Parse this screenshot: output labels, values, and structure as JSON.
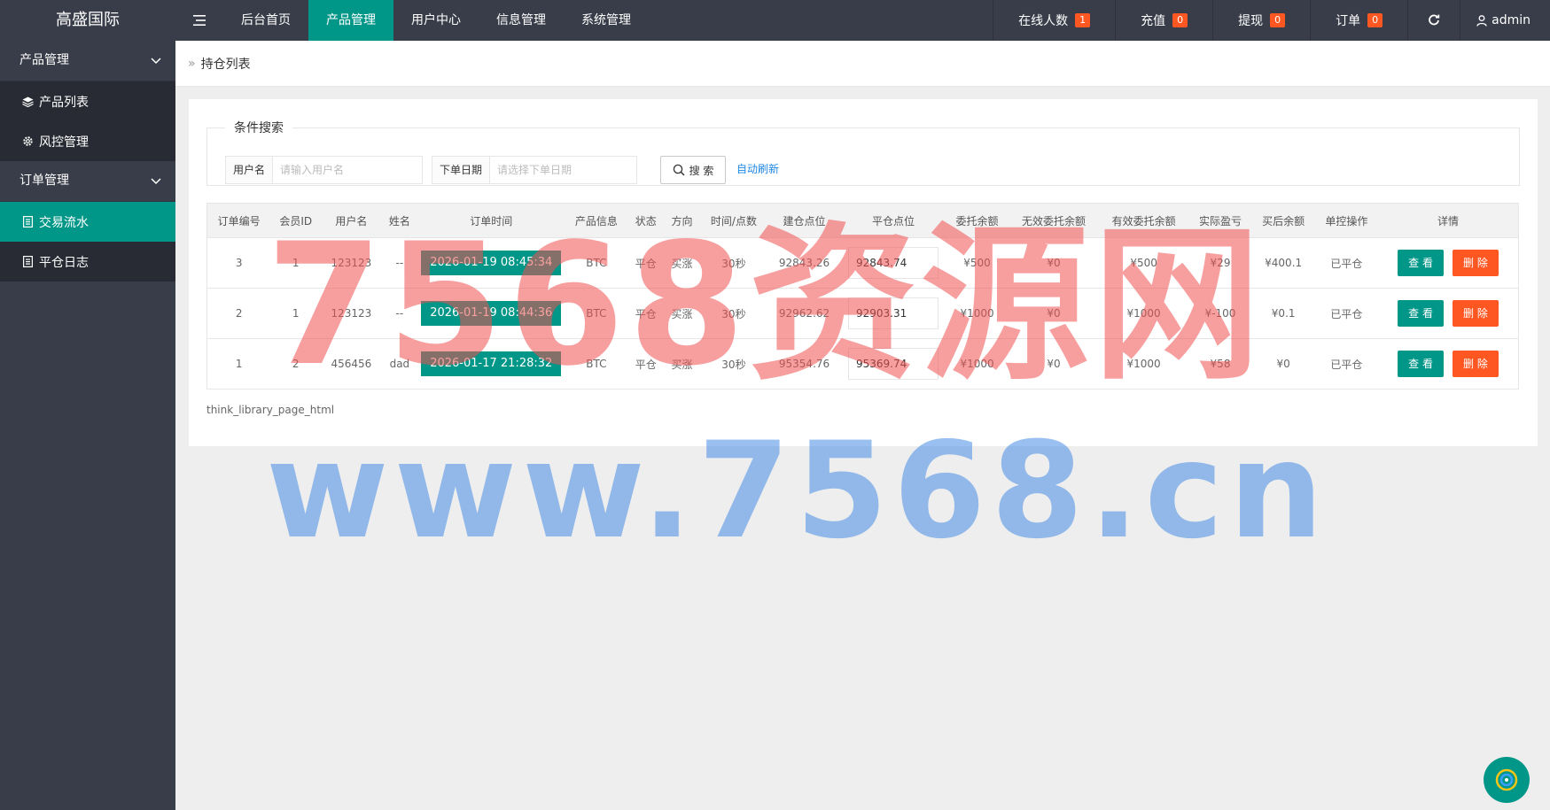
{
  "header": {
    "logo": "高盛国际",
    "nav": [
      "后台首页",
      "产品管理",
      "用户中心",
      "信息管理",
      "系统管理"
    ],
    "active_nav": 1,
    "right": {
      "online_label": "在线人数",
      "online_count": "1",
      "recharge_label": "充值",
      "recharge_count": "0",
      "withdraw_label": "提现",
      "withdraw_count": "0",
      "order_label": "订单",
      "order_count": "0",
      "user": "admin"
    }
  },
  "sidebar": {
    "group1": "产品管理",
    "items1": [
      "产品列表",
      "风控管理"
    ],
    "group2": "订单管理",
    "items2": [
      "交易流水",
      "平仓日志"
    ]
  },
  "breadcrumb": "持仓列表",
  "search": {
    "legend": "条件搜索",
    "username_label": "用户名",
    "username_placeholder": "请输入用户名",
    "date_label": "下单日期",
    "date_placeholder": "请选择下单日期",
    "search_btn": "搜 索",
    "auto_refresh": "自动刷新"
  },
  "table": {
    "headers": [
      "订单编号",
      "会员ID",
      "用户名",
      "姓名",
      "订单时间",
      "产品信息",
      "状态",
      "方向",
      "时间/点数",
      "建仓点位",
      "平仓点位",
      "委托余额",
      "无效委托余额",
      "有效委托余额",
      "实际盈亏",
      "买后余额",
      "单控操作",
      "详情"
    ],
    "rows": [
      {
        "id": "3",
        "uid": "1",
        "username": "123123",
        "name": "--",
        "time": "2026-01-19 08:45:34",
        "product": "BTC",
        "status": "平仓",
        "direction": "买涨",
        "duration": "30秒",
        "open": "92843.26",
        "close": "92843.74",
        "entrust": "¥500",
        "invalid": "¥0",
        "valid": "¥500",
        "pnl": "¥29",
        "after": "¥400.1",
        "control": "已平仓",
        "view": "查 看",
        "del": "删 除"
      },
      {
        "id": "2",
        "uid": "1",
        "username": "123123",
        "name": "--",
        "time": "2026-01-19 08:44:36",
        "product": "BTC",
        "status": "平仓",
        "direction": "买涨",
        "duration": "30秒",
        "open": "92962.62",
        "close": "92903.31",
        "entrust": "¥1000",
        "invalid": "¥0",
        "valid": "¥1000",
        "pnl": "¥-100",
        "after": "¥0.1",
        "control": "已平仓",
        "view": "查 看",
        "del": "删 除"
      },
      {
        "id": "1",
        "uid": "2",
        "username": "456456",
        "name": "dad",
        "time": "2026-01-17 21:28:32",
        "product": "BTC",
        "status": "平仓",
        "direction": "买涨",
        "duration": "30秒",
        "open": "95354.76",
        "close": "95369.74",
        "entrust": "¥1000",
        "invalid": "¥0",
        "valid": "¥1000",
        "pnl": "¥58",
        "after": "¥0",
        "control": "已平仓",
        "view": "查 看",
        "del": "删 除"
      }
    ]
  },
  "pager": "think_library_page_html",
  "watermark": {
    "line1": "7568资源网",
    "line2": "www.7568.cn"
  },
  "colors": {
    "primary": "#009688",
    "danger": "#ff5722",
    "header": "#393d49"
  }
}
